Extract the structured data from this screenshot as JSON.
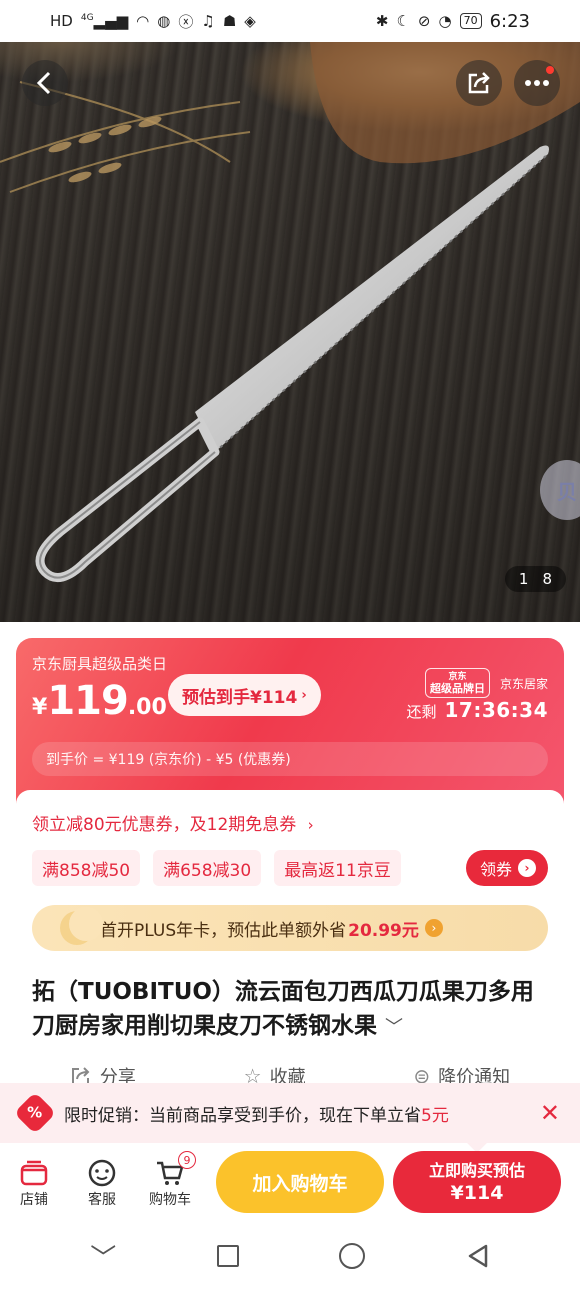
{
  "status_bar": {
    "network": "HD",
    "signal": "4G",
    "battery": "70",
    "time": "6:23"
  },
  "hero": {
    "page_current": "1",
    "page_total": "8",
    "side_badge": "贝"
  },
  "promo": {
    "title": "京东厨具超级品类日",
    "currency": "¥",
    "price_int": "119",
    "price_dec": ".00",
    "estimate": "预估到手¥114",
    "brand_event": "超级品牌日",
    "brand_event_top": "京东",
    "brand_name": "京东居家",
    "countdown_label": "还剩",
    "countdown": "17:36:34",
    "formula": "到手价 = ¥119 (京东价) - ¥5 (优惠券)"
  },
  "coupons": {
    "headline": "领立减80元优惠券，及12期免息券",
    "chips": [
      "满858减50",
      "满658减30",
      "最高返11京豆"
    ],
    "claim_label": "领券"
  },
  "plus": {
    "text": "首开PLUS年卡，预估此单额外省",
    "amount": "20.99元"
  },
  "product": {
    "title": "拓（TUOBITUO）流云面包刀西瓜刀瓜果刀多用刀厨房家用削切果皮刀不锈钢水果",
    "expand_icon": "chevron-down-icon"
  },
  "actions": [
    {
      "label": "分享",
      "icon": "share-icon"
    },
    {
      "label": "收藏",
      "icon": "star-icon"
    },
    {
      "label": "降价通知",
      "icon": "price-tag-icon"
    }
  ],
  "toast": {
    "prefix": "限时促销：当前商品享受到手价，现在下单立省",
    "amount": "5元"
  },
  "bottom_bar": {
    "nav": [
      {
        "label": "店铺",
        "icon": "shop-icon"
      },
      {
        "label": "客服",
        "icon": "service-icon"
      },
      {
        "label": "购物车",
        "icon": "cart-icon"
      }
    ],
    "cart_count": "9",
    "add_to_cart": "加入购物车",
    "buy_line1": "立即购买预估",
    "buy_line2": "¥114"
  },
  "colors": {
    "accent": "#e8293b",
    "cart_yellow": "#fbc22b",
    "plus_gold": "#fbe4b8"
  }
}
